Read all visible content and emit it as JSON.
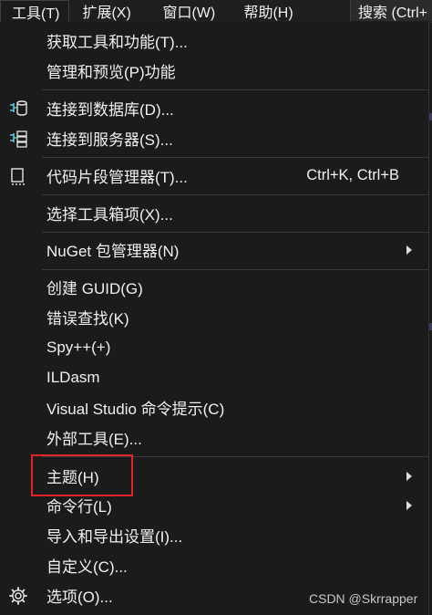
{
  "menubar": {
    "items": [
      {
        "label": "工具(T)"
      },
      {
        "label": "扩展(X)"
      },
      {
        "label": "窗口(W)"
      },
      {
        "label": "帮助(H)"
      }
    ],
    "search_label": "搜索 (Ctrl+"
  },
  "menu": {
    "items": [
      {
        "label": "获取工具和功能(T)..."
      },
      {
        "label": "管理和预览(P)功能"
      },
      {
        "label": "连接到数据库(D)...",
        "icon": "database-connect-icon"
      },
      {
        "label": "连接到服务器(S)...",
        "icon": "server-connect-icon"
      },
      {
        "label": "代码片段管理器(T)...",
        "icon": "snippet-icon",
        "shortcut": "Ctrl+K, Ctrl+B"
      },
      {
        "label": "选择工具箱项(X)..."
      },
      {
        "label": "NuGet 包管理器(N)",
        "submenu": true
      },
      {
        "label": "创建 GUID(G)"
      },
      {
        "label": "错误查找(K)"
      },
      {
        "label": "Spy++(+)"
      },
      {
        "label": "ILDasm"
      },
      {
        "label": "Visual Studio 命令提示(C)"
      },
      {
        "label": "外部工具(E)..."
      },
      {
        "label": "主题(H)",
        "submenu": true,
        "highlighted": true
      },
      {
        "label": "命令行(L)",
        "submenu": true
      },
      {
        "label": "导入和导出设置(I)..."
      },
      {
        "label": "自定义(C)..."
      },
      {
        "label": "选项(O)...",
        "icon": "gear-icon"
      }
    ]
  },
  "watermark": "CSDN @Skrrapper",
  "colors": {
    "background": "#1b1b1c",
    "text": "#f1f1f1",
    "highlight_box": "#e0242a",
    "icon_accent": "#5cc6e0"
  }
}
